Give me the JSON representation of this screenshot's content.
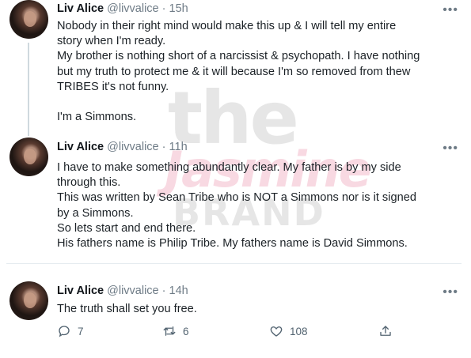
{
  "tweets": [
    {
      "name": "Liv Alice",
      "handle": "@livvalice",
      "time": "15h",
      "lines": [
        "Nobody in their right mind would make this up & I will tell my entire",
        "story when I'm ready.",
        "My brother is nothing short of a narcissist & psychopath. I have nothing",
        "but my truth to protect me & it will because I'm so removed from thew",
        "TRIBES it's not funny.",
        "",
        "I'm a Simmons."
      ]
    },
    {
      "name": "Liv Alice",
      "handle": "@livvalice",
      "time": "11h",
      "lines": [
        "I have to make something abundantly clear. My father is by my side",
        "through this.",
        "This was written by Sean Tribe who is NOT a Simmons nor is it signed",
        "by a Simmons.",
        "So lets start and end there.",
        "His fathers name is Philip Tribe. My fathers name is David Simmons."
      ]
    },
    {
      "name": "Liv Alice",
      "handle": "@livvalice",
      "time": "14h",
      "lines": [
        "The truth shall set you free."
      ]
    }
  ],
  "actions": {
    "reply_count": "7",
    "retweet_count": "6",
    "like_count": "108"
  },
  "watermark": {
    "line1": "the",
    "line2": "Jasmine",
    "line3": "BRAND"
  },
  "colors": {
    "text": "#0f1419",
    "secondary": "#6e7b86",
    "divider": "#e6ecf0",
    "watermark_gray": "#d9d9d9",
    "watermark_pink": "#f6c9d3"
  }
}
